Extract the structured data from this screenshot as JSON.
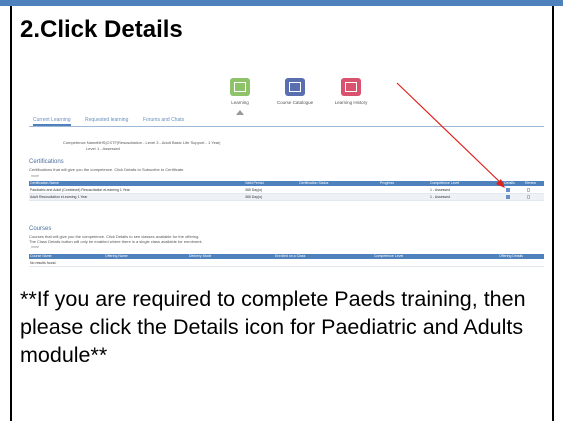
{
  "heading": "2.Click Details",
  "note": "**If you are required to complete Paeds training, then please click the Details icon for Paediatric and Adults module**",
  "colors": {
    "accent": "#4f81bd",
    "arrow": "#e0201b"
  },
  "app": {
    "nav_tiles": [
      {
        "label": "Learning",
        "color": "#8fc36a",
        "icon": "learning-icon"
      },
      {
        "label": "Course Catalogue",
        "color": "#5a6fb0",
        "icon": "catalogue-icon"
      },
      {
        "label": "Learning History",
        "color": "#d9536f",
        "icon": "history-icon"
      }
    ],
    "tabs": [
      "Current Learning",
      "Requested learning",
      "Forums and Chats"
    ],
    "competence_name_label": "Competence Name",
    "competence_name_value": "NHS|CSTF|Resuscitation - Level 3 - Adult Basic Life Support - 1 Year|",
    "level_label": "Level",
    "level_value": "1 - Assessed",
    "certifications": {
      "title": "Certifications",
      "description": "Certifications that will give you the competence. Click Details to Subscribe to Certificate.",
      "more_label": "more",
      "headers": [
        "Certification Name",
        "Valid Period",
        "Certification Status",
        "Progress",
        "Competence Level",
        "Details",
        "Renew"
      ],
      "rows": [
        {
          "name": "Paediatric and Adult (Combined) Resuscitation eLearning 1 Year",
          "valid_period": "365 Day(s)",
          "status": "",
          "progress": "",
          "level": "1 - Assessed"
        },
        {
          "name": "Adult Resuscitation eLearning 1 Year",
          "valid_period": "365 Day(s)",
          "status": "",
          "progress": "",
          "level": "1 - Assessed"
        }
      ]
    },
    "courses": {
      "title": "Courses",
      "description_1": "Courses that will give you the competence. Click Details to see classes available for the offering.",
      "description_2": "The Class Details button will only be enabled where there is a single class available for enrolment.",
      "more_label": "more",
      "headers": [
        "Course Name",
        "Offering Name",
        "Delivery Mode",
        "Enrolled on a Class",
        "Competence Level",
        "Offering Details"
      ],
      "empty_text": "No results found."
    }
  }
}
